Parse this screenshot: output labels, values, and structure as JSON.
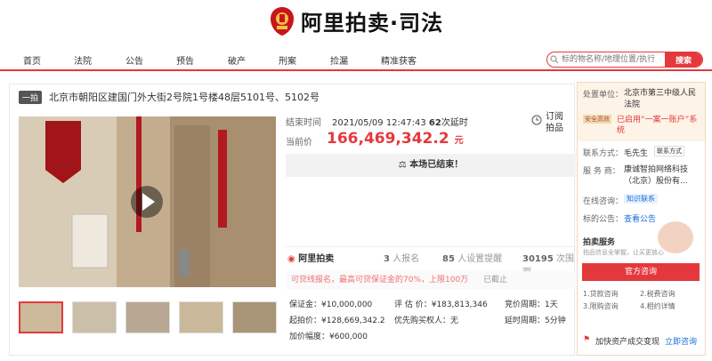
{
  "brand": {
    "name": "阿里拍卖·司法"
  },
  "nav": {
    "items": [
      "首页",
      "法院",
      "公告",
      "预告",
      "破产",
      "刑案",
      "捡漏",
      "精准获客"
    ]
  },
  "search": {
    "placeholder": "标的物名称/地理位置/执行",
    "button": "搜索"
  },
  "item": {
    "badge": "一拍",
    "title": "北京市朝阳区建国门外大街2号院1号楼48层5101号、5102号"
  },
  "auction": {
    "end_label": "结束时间",
    "end_time": "2021/05/09 12:47:43",
    "delay_count": "62",
    "delay_text": "次延时",
    "subscribe_line1": "订阅",
    "subscribe_line2": "拍品",
    "price_label": "当前价",
    "price": "166,469,342.2",
    "price_unit": "元",
    "ended_text": "本场已结束！",
    "brand": "阿里拍卖",
    "signups": "3",
    "signups_label": "人报名",
    "reminders": "85",
    "reminders_label": "人设置提醒",
    "views": "30195",
    "views_label": "次围观",
    "tip": "可贷线报名，最高可贷保证金的70%，上限100万",
    "tip_status": "已截止",
    "deposit_label": "保证金：",
    "deposit": "¥10,000,000",
    "estimate_label": "评 估 价：",
    "estimate": "¥183,813,346",
    "cycle_label": "竞价周期：",
    "cycle": "1天",
    "start_label": "起拍价：",
    "start_price": "¥128,669,342.2",
    "priority_label": "优先购买权人：",
    "priority": "无",
    "delay_cycle_label": "延时周期：",
    "delay_cycle": "5分钟",
    "increment_label": "加价幅度：",
    "increment": "¥600,000"
  },
  "side": {
    "unit_label": "处置单位：",
    "unit": "北京市第三中级人民法院",
    "safety_badge": "安全高效",
    "enabled_text": "已启用“一案一账户”系统",
    "contact_label": "联系方式：",
    "contact": "毛先生",
    "contact_btn": "联系方式",
    "service_label": "服 务 商：",
    "service": "康诚智拍网络科技（北京）股份有...",
    "consult_label": "在线咨询：",
    "consult": "知识联系",
    "notice_label": "标的公告：",
    "notice": "查看公告",
    "svc_title": "拍卖服务",
    "svc_sub": "拍品信息全掌握，让买更放心",
    "official_btn": "官方咨询",
    "links": [
      "1.贷款咨询",
      "2.税费咨询",
      "3.限购咨询",
      "4.相约详情"
    ],
    "bottom_text": "加快资产成交变现",
    "bottom_link": "立即咨询"
  },
  "colors": {
    "accent": "#e4393c",
    "text": "#333333"
  }
}
